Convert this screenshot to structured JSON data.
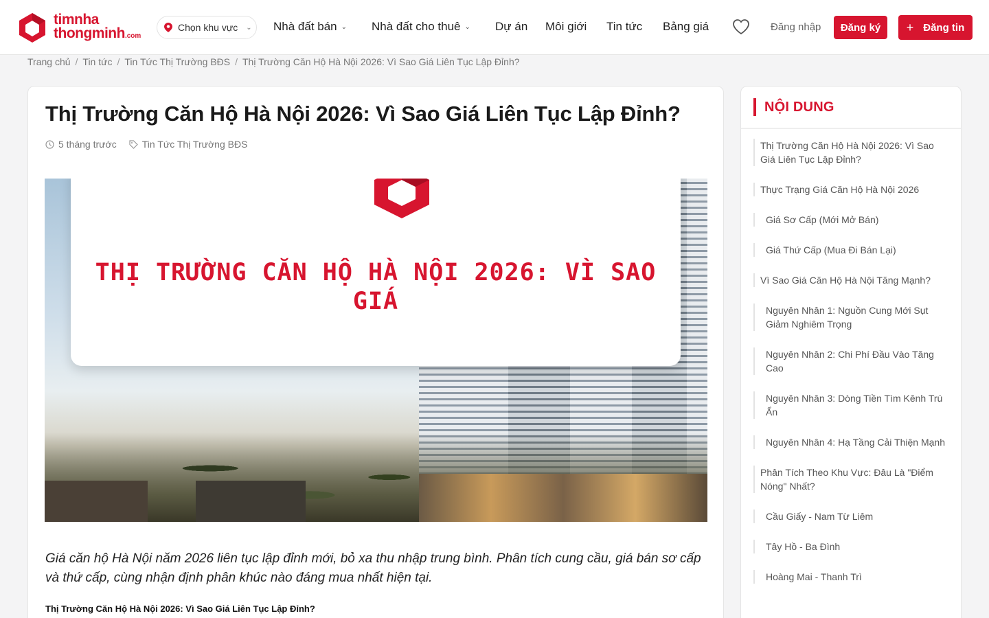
{
  "header": {
    "logo_line1": "timnha",
    "logo_line2": "thongminh",
    "logo_suffix": ".com",
    "region_label": "Chọn khu vực",
    "nav": [
      {
        "label": "Nhà đất bán",
        "dropdown": true
      },
      {
        "label": "Nhà đất cho thuê",
        "dropdown": true
      },
      {
        "label": "Dự án",
        "dropdown": false
      },
      {
        "label": "Môi giới",
        "dropdown": false
      },
      {
        "label": "Tin tức",
        "dropdown": false
      },
      {
        "label": "Bảng giá",
        "dropdown": false
      }
    ],
    "login_label": "Đăng nhập",
    "register_label": "Đăng ký",
    "post_label": "Đăng tin",
    "post_icon": "+"
  },
  "breadcrumb": [
    "Trang chủ",
    "Tin tức",
    "Tin Tức Thị Trường BĐS",
    "Thị Trường Căn Hộ Hà Nội 2026: Vì Sao Giá Liên Tục Lập Đỉnh?"
  ],
  "article": {
    "title": "Thị Trường Căn Hộ Hà Nội 2026: Vì Sao Giá Liên Tục Lập Đỉnh?",
    "time_ago": "5 tháng trước",
    "category": "Tin Tức Thị Trường BĐS",
    "hero_text_line1": "THỊ TRƯỜNG CĂN HỘ HÀ NỘI 2026: VÌ SAO",
    "hero_text_line2": "GIÁ",
    "lead": "Giá căn hộ Hà Nội năm 2026 liên tục lập đỉnh mới, bỏ xa thu nhập trung bình. Phân tích cung cầu, giá bán sơ cấp và thứ cấp, cùng nhận định phân khúc nào đáng mua nhất hiện tại.",
    "first_heading": "Thị Trường Căn Hộ Hà Nội 2026: Vì Sao Giá Liên Tục Lập Đỉnh?"
  },
  "toc": {
    "title": "NỘI DUNG",
    "items": [
      {
        "label": "Thị Trường Căn Hộ Hà Nội 2026: Vì Sao Giá Liên Tục Lập Đỉnh?",
        "level": 1
      },
      {
        "label": "Thực Trạng Giá Căn Hộ Hà Nội 2026",
        "level": 1
      },
      {
        "label": "Giá Sơ Cấp (Mới Mở Bán)",
        "level": 2
      },
      {
        "label": "Giá Thứ Cấp (Mua Đi Bán Lại)",
        "level": 2
      },
      {
        "label": "Vì Sao Giá Căn Hộ Hà Nội Tăng Mạnh?",
        "level": 1
      },
      {
        "label": "Nguyên Nhân 1: Nguồn Cung Mới Sụt Giảm Nghiêm Trọng",
        "level": 2
      },
      {
        "label": "Nguyên Nhân 2: Chi Phí Đầu Vào Tăng Cao",
        "level": 2
      },
      {
        "label": "Nguyên Nhân 3: Dòng Tiền Tìm Kênh Trú Ẩn",
        "level": 2
      },
      {
        "label": "Nguyên Nhân 4: Hạ Tầng Cải Thiện Mạnh",
        "level": 2
      },
      {
        "label": "Phân Tích Theo Khu Vực: Đâu Là \"Điểm Nóng\" Nhất?",
        "level": 1
      },
      {
        "label": "Cầu Giấy - Nam Từ Liêm",
        "level": 2
      },
      {
        "label": "Tây Hồ - Ba Đình",
        "level": 2
      },
      {
        "label": "Hoàng Mai - Thanh Trì",
        "level": 2
      }
    ]
  },
  "colors": {
    "brand": "#d7152f"
  }
}
